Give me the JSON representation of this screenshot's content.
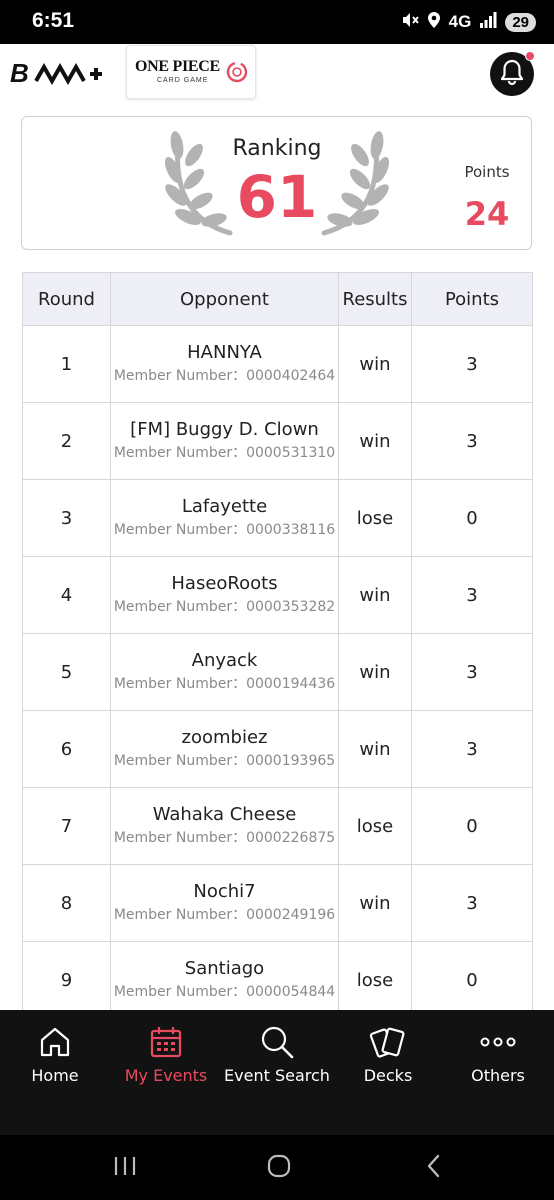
{
  "status_bar": {
    "time": "6:51",
    "network": "4G",
    "battery": "29",
    "icons": [
      "mute-icon",
      "location-icon",
      "signal-icon",
      "battery-icon"
    ]
  },
  "header": {
    "brand_logo": "B",
    "game_logo_title": "ONE PIECE",
    "game_logo_subtitle": "CARD GAME",
    "icons": [
      "bell-icon"
    ],
    "accent_color": "#e84a5f"
  },
  "ranking": {
    "label": "Ranking",
    "value": "61",
    "points_label": "Points",
    "points_value": "24"
  },
  "table": {
    "headers": [
      "Round",
      "Opponent",
      "Results",
      "Points"
    ],
    "member_prefix": "Member Number：",
    "rows": [
      {
        "round": "1",
        "name": "HANNYA",
        "member": "Member Number：0000402464",
        "result": "win",
        "points": "3"
      },
      {
        "round": "2",
        "name": "[FM] Buggy D. Clown",
        "member": "Member Number：0000531310",
        "result": "win",
        "points": "3"
      },
      {
        "round": "3",
        "name": "Lafayette",
        "member": "Member Number：0000338116",
        "result": "lose",
        "points": "0"
      },
      {
        "round": "4",
        "name": "HaseoRoots",
        "member": "Member Number：0000353282",
        "result": "win",
        "points": "3"
      },
      {
        "round": "5",
        "name": "Anyack",
        "member": "Member Number：0000194436",
        "result": "win",
        "points": "3"
      },
      {
        "round": "6",
        "name": "zoombiez",
        "member": "Member Number：0000193965",
        "result": "win",
        "points": "3"
      },
      {
        "round": "7",
        "name": "Wahaka Cheese",
        "member": "Member Number：0000226875",
        "result": "lose",
        "points": "0"
      },
      {
        "round": "8",
        "name": "Nochi7",
        "member": "Member Number：0000249196",
        "result": "win",
        "points": "3"
      },
      {
        "round": "9",
        "name": "Santiago",
        "member": "Member Number：0000054844",
        "result": "lose",
        "points": "0"
      }
    ]
  },
  "bottom_nav": {
    "items": [
      {
        "label": "Home",
        "icon": "home-icon",
        "active": false
      },
      {
        "label": "My Events",
        "icon": "calendar-icon",
        "active": true
      },
      {
        "label": "Event Search",
        "icon": "search-icon",
        "active": false
      },
      {
        "label": "Decks",
        "icon": "cards-icon",
        "active": false
      },
      {
        "label": "Others",
        "icon": "more-icon",
        "active": false
      }
    ]
  },
  "system_nav": {
    "icons": [
      "recents-icon",
      "home-circle-icon",
      "back-icon"
    ]
  }
}
